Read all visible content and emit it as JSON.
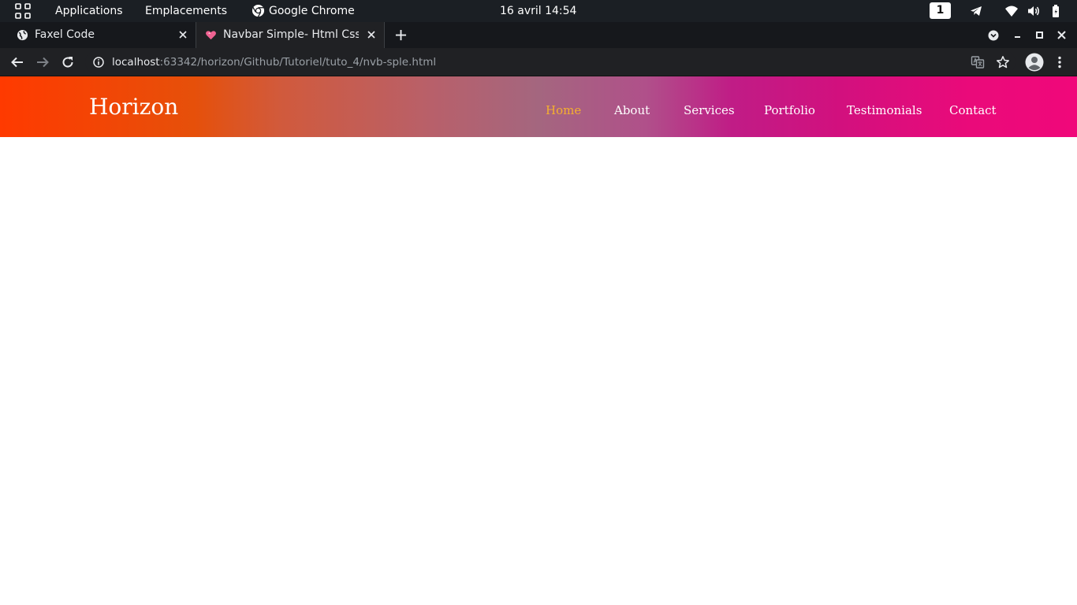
{
  "system_bar": {
    "applications": "Applications",
    "places": "Emplacements",
    "active_app": "Google Chrome",
    "clock": "16 avril  14:54",
    "workspace": "1"
  },
  "browser": {
    "tabs": [
      {
        "title": "Faxel Code",
        "active": false
      },
      {
        "title": "Navbar Simple- Html Css",
        "active": true
      }
    ],
    "url_host": "localhost",
    "url_path": ":63342/horizon/Github/Tutoriel/tuto_4/nvb-sple.html"
  },
  "page": {
    "brand": "Horizon",
    "nav": [
      {
        "label": "Home",
        "current": true
      },
      {
        "label": "About",
        "current": false
      },
      {
        "label": "Services",
        "current": false
      },
      {
        "label": "Portfolio",
        "current": false
      },
      {
        "label": "Testimonials",
        "current": false
      },
      {
        "label": "Contact",
        "current": false
      }
    ],
    "colors": {
      "gradient_start": "#ff3a00",
      "gradient_end": "#f0087a",
      "active_link": "#f5b02e"
    }
  }
}
